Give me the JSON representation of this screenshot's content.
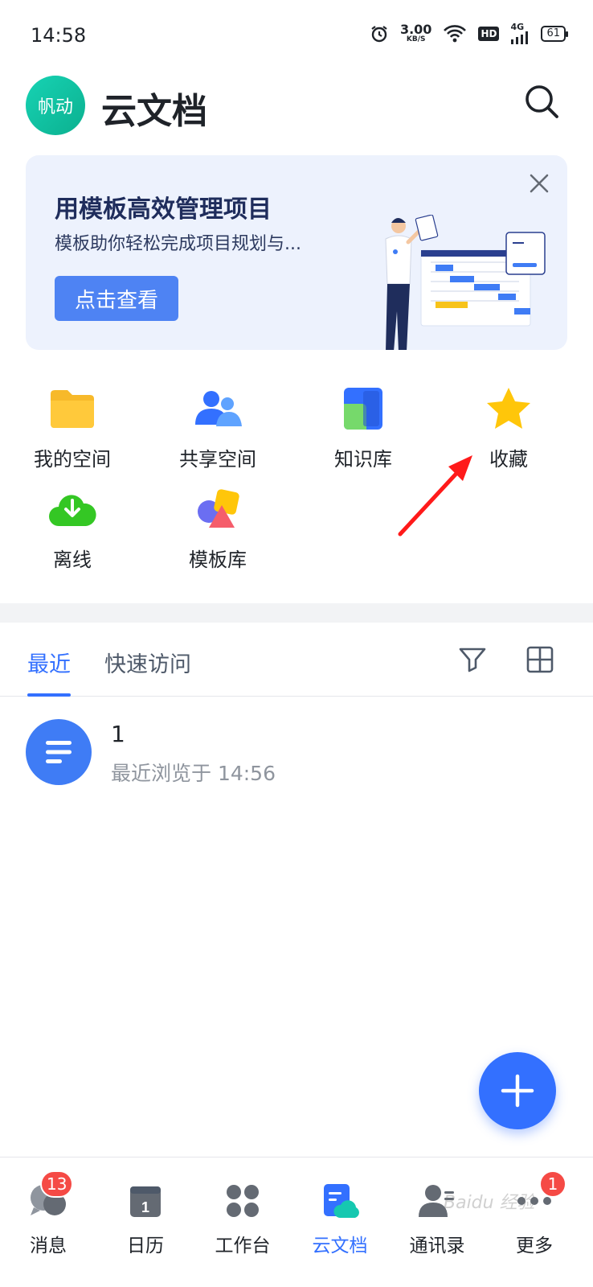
{
  "status_bar": {
    "time": "14:58",
    "net_speed": "3.00",
    "net_unit": "KB/S",
    "hd": "HD",
    "network": "4G",
    "battery": "61"
  },
  "header": {
    "avatar_text": "帆动",
    "title": "云文档"
  },
  "banner": {
    "title": "用模板高效管理项目",
    "subtitle": "模板助你轻松完成项目规划与...",
    "button_label": "点击查看"
  },
  "quick_access": [
    {
      "label": "我的空间",
      "icon": "folder-icon"
    },
    {
      "label": "共享空间",
      "icon": "shared-users-icon"
    },
    {
      "label": "知识库",
      "icon": "knowledge-base-icon"
    },
    {
      "label": "收藏",
      "icon": "star-icon"
    },
    {
      "label": "离线",
      "icon": "offline-download-icon"
    },
    {
      "label": "模板库",
      "icon": "template-library-icon"
    }
  ],
  "tabs": {
    "recent": "最近",
    "quick": "快速访问"
  },
  "recent_list": [
    {
      "name": "1",
      "meta": "最近浏览于 14:56"
    }
  ],
  "bottom_nav": [
    {
      "label": "消息",
      "badge": "13"
    },
    {
      "label": "日历",
      "calendar_day": "1"
    },
    {
      "label": "工作台"
    },
    {
      "label": "云文档"
    },
    {
      "label": "通讯录"
    },
    {
      "label": "更多",
      "badge": "1"
    }
  ],
  "watermark": "Baidu 经验",
  "colors": {
    "accent": "#3370ff",
    "avatar": "#0fc3a1",
    "banner_bg": "#edf2fd",
    "badge": "#f54a45"
  }
}
